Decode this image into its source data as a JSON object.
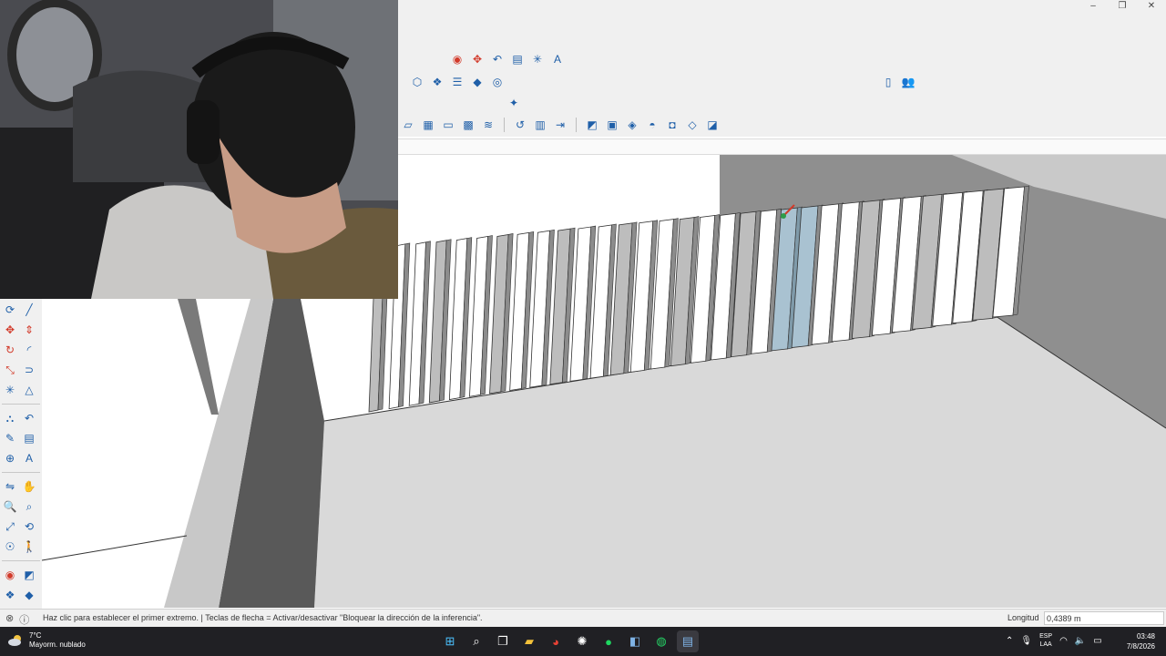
{
  "window": {
    "minimize_glyph": "–",
    "maximize_glyph": "❐",
    "close_glyph": "✕"
  },
  "toolbar": {
    "row1_icons": [
      "look-around-icon",
      "move-icon",
      "follow-me-icon",
      "text-icon",
      "axes-icon",
      "3d-text-icon"
    ],
    "row2_icons": [
      "sandbox-icon",
      "components-icon",
      "layers-icon",
      "materials-icon",
      "account-icon"
    ],
    "row3_icons": [
      "extensions-icon"
    ],
    "row4_icons": [
      "view-iso-icon",
      "view-top-icon",
      "view-front-icon",
      "view-right-icon",
      "view-back-icon",
      "undo-icon",
      "report-icon",
      "forward-icon",
      "section-plane-icon",
      "section-cuts-icon",
      "sandbox-from-contours-icon",
      "drape-icon",
      "stamp-icon",
      "flip-edge-icon",
      "add-detail-icon"
    ],
    "right_icons": [
      "new-file-icon",
      "user-icon"
    ]
  },
  "palette": {
    "rows": [
      [
        "orbit-icon",
        "line-icon"
      ],
      [
        "move-icon",
        "push-pull-icon"
      ],
      [
        "rotate-icon",
        "arc-icon"
      ],
      [
        "scale-icon",
        "offset-icon"
      ],
      [
        "axes-icon",
        "protractor-icon"
      ],
      [
        "paint-icon",
        "follow-me-icon"
      ],
      [
        "tape-measure-icon",
        "text-icon"
      ],
      [
        "dimension-icon",
        "3d-text-icon"
      ],
      [
        "section-icon",
        "pan-icon"
      ],
      [
        "zoom-icon",
        "zoom-window-icon"
      ],
      [
        "zoom-extents-icon",
        "orbit-camera-icon"
      ],
      [
        "position-camera-icon",
        "walk-icon"
      ],
      [
        "look-around-icon",
        "section-plane-icon"
      ],
      [
        "components-icon",
        "materials-icon"
      ],
      [
        "layers-icon",
        "styles-icon"
      ]
    ]
  },
  "status": {
    "text": "Haz clic para establecer el primer extremo. | Teclas de flecha = Activar/desactivar \"Bloquear la dirección de la inferencia\".",
    "measurement_label": "Longitud",
    "measurement_value": "0,4389 m"
  },
  "taskbar": {
    "temperature": "7°C",
    "weather": "Mayorm. nublado",
    "apps": [
      "windows-start-icon",
      "search-icon",
      "task-view-icon",
      "file-explorer-icon",
      "chrome-icon",
      "chatgpt-icon",
      "spotify-icon",
      "sketchup-icon",
      "whatsapp-icon",
      "sketchup-layout-icon"
    ],
    "lang_top": "ESP",
    "lang_bottom": "LAA",
    "time": "03:48",
    "date": "7/8/2026"
  },
  "colors": {
    "chrome_bg": "#f0f0f0",
    "icon_blue": "#1f5fa8",
    "icon_red": "#d23a2a",
    "taskbar_bg": "#202024",
    "floor_gray": "#d9d9d9",
    "wall_gray": "#a6a6a6",
    "selected_blue": "#a9c2d1"
  }
}
